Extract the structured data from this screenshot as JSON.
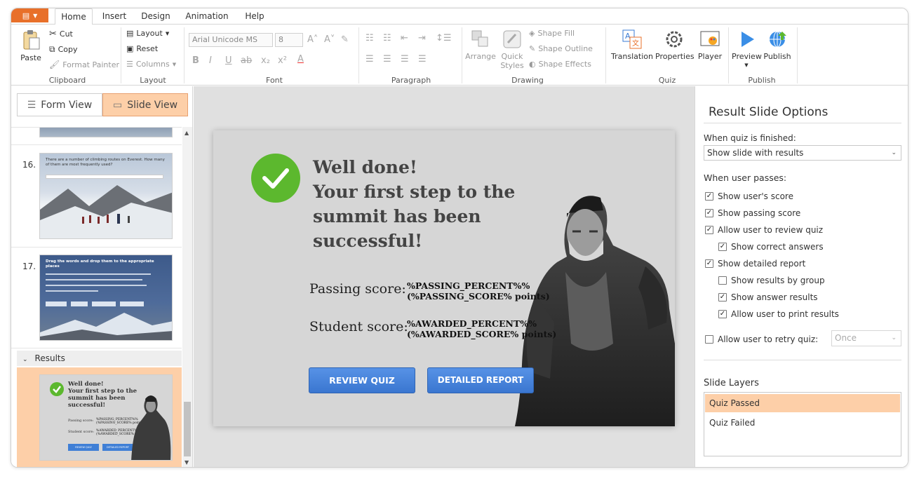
{
  "tabs": [
    "Home",
    "Insert",
    "Design",
    "Animation",
    "Help"
  ],
  "clipboard": {
    "paste": "Paste",
    "cut": "Cut",
    "copy": "Copy",
    "format_painter": "Format Painter",
    "label": "Clipboard"
  },
  "layout": {
    "layout": "Layout",
    "reset": "Reset",
    "columns": "Columns",
    "label": "Layout"
  },
  "font": {
    "family": "Arial Unicode MS",
    "size": "8",
    "label": "Font"
  },
  "paragraph": {
    "label": "Paragraph"
  },
  "drawing": {
    "arrange": "Arrange",
    "quick_styles": "Quick Styles",
    "shape_fill": "Shape Fill",
    "shape_outline": "Shape Outline",
    "shape_effects": "Shape Effects",
    "label": "Drawing"
  },
  "quiz": {
    "translation": "Translation",
    "properties": "Properties",
    "player": "Player",
    "label": "Quiz"
  },
  "publish": {
    "preview": "Preview",
    "publish": "Publish",
    "label": "Publish"
  },
  "views": {
    "form": "Form View",
    "slide": "Slide View"
  },
  "slides": [
    {
      "num": "16.",
      "text": "There are a number of climbing routes on Everest. How many of them are most frequently used?"
    },
    {
      "num": "17.",
      "text": "Drag the words and drop them to the appropriate places"
    }
  ],
  "results_group": "Results",
  "result_slide": {
    "heading_lines": [
      "Well done!",
      "Your first step to the",
      "summit has been",
      "successful!"
    ],
    "passing_label": "Passing score:",
    "passing_value_1": "%PASSING_PERCENT%%",
    "passing_value_2": "(%PASSING_SCORE% points)",
    "student_label": "Student score:",
    "student_value_1": "%AWARDED_PERCENT%%",
    "student_value_2": "(%AWARDED_SCORE% points)",
    "review_button": "REVIEW QUIZ",
    "report_button": "DETAILED REPORT"
  },
  "options": {
    "title": "Result Slide Options",
    "finished_label": "When quiz is finished:",
    "finished_value": "Show slide with results",
    "passes_label": "When user passes:",
    "items": [
      {
        "label": "Show user's score",
        "checked": true,
        "indent": 0
      },
      {
        "label": "Show passing score",
        "checked": true,
        "indent": 0
      },
      {
        "label": "Allow user to review quiz",
        "checked": true,
        "indent": 0
      },
      {
        "label": "Show correct answers",
        "checked": true,
        "indent": 1
      },
      {
        "label": "Show detailed report",
        "checked": true,
        "indent": 0
      },
      {
        "label": "Show results by group",
        "checked": false,
        "indent": 1
      },
      {
        "label": "Show answer results",
        "checked": true,
        "indent": 1
      },
      {
        "label": "Allow user to print results",
        "checked": true,
        "indent": 1
      }
    ],
    "retry_label": "Allow user to retry quiz:",
    "retry_value": "Once",
    "layers_title": "Slide Layers",
    "layers": [
      "Quiz Passed",
      "Quiz Failed"
    ]
  },
  "colors": {
    "accent": "#e8702a",
    "selected": "#fdcfa8",
    "button": "#3f7fd6",
    "check": "#5cb82e"
  }
}
